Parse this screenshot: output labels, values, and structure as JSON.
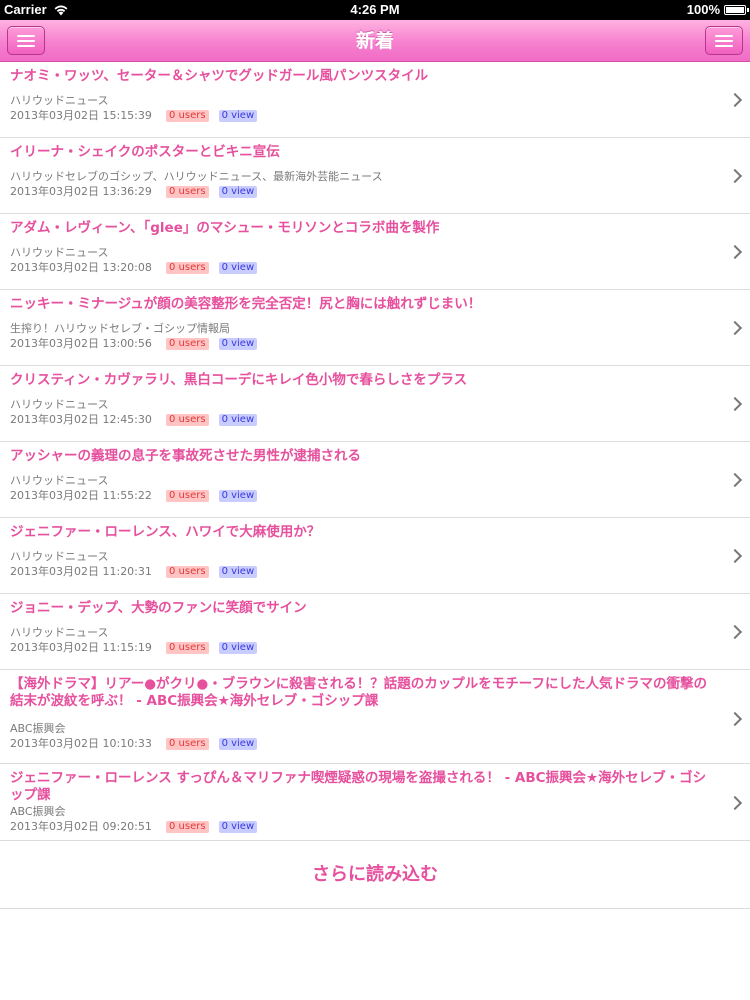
{
  "status_bar": {
    "carrier": "Carrier",
    "time": "4:26 PM",
    "battery": "100%"
  },
  "nav": {
    "title": "新着"
  },
  "colors": {
    "accent": "#e6509d",
    "nav_pink": "#f680cf",
    "users_badge_bg": "#ffc4c4",
    "view_badge_bg": "#c9ccff"
  },
  "articles": [
    {
      "title": "ナオミ・ワッツ、セーター＆シャツでグッドガール風パンツスタイル",
      "source": "ハリウッドニュース",
      "date": "2013年03月02日 15:15:39",
      "users": "0 users",
      "views": "0 view"
    },
    {
      "title": "イリーナ・シェイクのポスターとビキニ宣伝",
      "source": "ハリウッドセレブのゴシップ、ハリウッドニュース、最新海外芸能ニュース",
      "date": "2013年03月02日 13:36:29",
      "users": "0 users",
      "views": "0 view"
    },
    {
      "title": "アダム・レヴィーン、「glee」のマシュー・モリソンとコラボ曲を製作",
      "source": "ハリウッドニュース",
      "date": "2013年03月02日 13:20:08",
      "users": "0 users",
      "views": "0 view"
    },
    {
      "title": "ニッキー・ミナージュが顔の美容整形を完全否定！尻と胸には触れずじまい！",
      "source": "生搾り！ハリウッドセレブ・ゴシップ情報局",
      "date": "2013年03月02日 13:00:56",
      "users": "0 users",
      "views": "0 view"
    },
    {
      "title": "クリスティン・カヴァラリ、黒白コーデにキレイ色小物で春らしさをプラス",
      "source": "ハリウッドニュース",
      "date": "2013年03月02日 12:45:30",
      "users": "0 users",
      "views": "0 view"
    },
    {
      "title": "アッシャーの義理の息子を事故死させた男性が逮捕される",
      "source": "ハリウッドニュース",
      "date": "2013年03月02日 11:55:22",
      "users": "0 users",
      "views": "0 view"
    },
    {
      "title": "ジェニファー・ローレンス、ハワイで大麻使用か？",
      "source": "ハリウッドニュース",
      "date": "2013年03月02日 11:20:31",
      "users": "0 users",
      "views": "0 view"
    },
    {
      "title": "ジョニー・デップ、大勢のファンに笑顔でサイン",
      "source": "ハリウッドニュース",
      "date": "2013年03月02日 11:15:19",
      "users": "0 users",
      "views": "0 view"
    },
    {
      "title": "【海外ドラマ】リアー●がクリ●・ブラウンに殺害される！？話題のカップルをモチーフにした人気ドラマの衝撃の結末が波紋を呼ぶ！ - ABC振興会★海外セレブ・ゴシップ課",
      "source": "ABC振興会",
      "date": "2013年03月02日 10:10:33",
      "users": "0 users",
      "views": "0 view"
    },
    {
      "title": "ジェニファー・ローレンス すっぴん＆マリファナ喫煙疑惑の現場を盗撮される！ - ABC振興会★海外セレブ・ゴシップ課",
      "source": "ABC振興会",
      "date": "2013年03月02日 09:20:51",
      "users": "0 users",
      "views": "0 view"
    }
  ],
  "load_more_label": "さらに読み込む"
}
